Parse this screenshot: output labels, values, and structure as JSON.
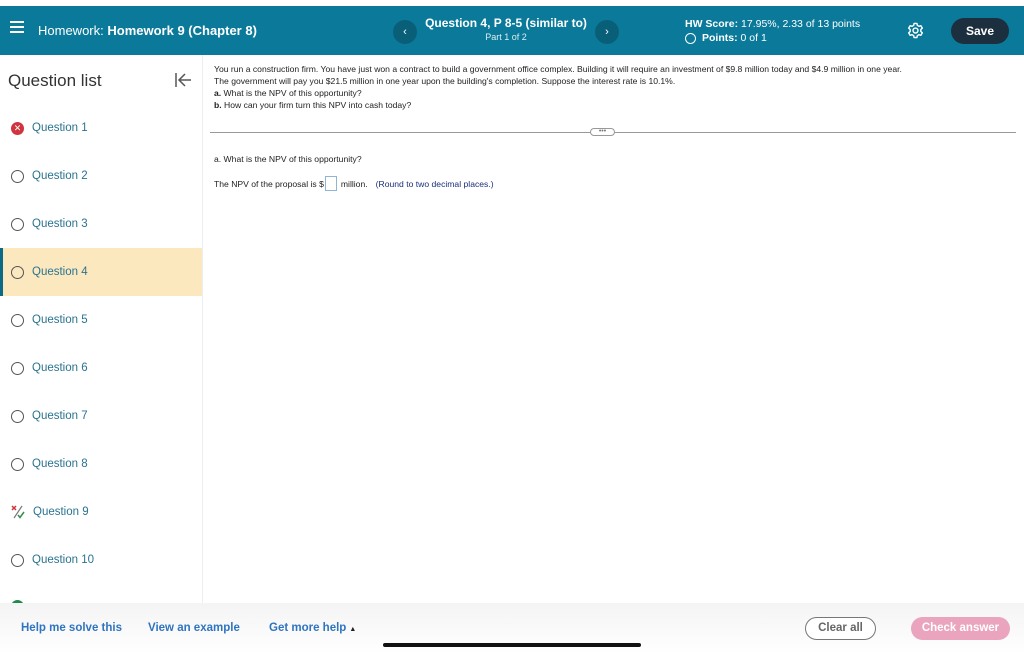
{
  "header": {
    "homework_prefix": "Homework:",
    "homework_title": "Homework 9 (Chapter 8)",
    "question_title": "Question 4, P 8-5 (similar to)",
    "question_part": "Part 1 of 2",
    "score_label": "HW Score:",
    "score_value": "17.95%, 2.33 of 13 points",
    "points_label": "Points:",
    "points_value": "0 of 1",
    "save_label": "Save",
    "prev_glyph": "‹",
    "next_glyph": "›"
  },
  "sidebar": {
    "title": "Question list",
    "items": [
      {
        "label": "Question 1",
        "status": "incorrect"
      },
      {
        "label": "Question 2",
        "status": "unanswered"
      },
      {
        "label": "Question 3",
        "status": "unanswered"
      },
      {
        "label": "Question 4",
        "status": "unanswered",
        "active": true
      },
      {
        "label": "Question 5",
        "status": "unanswered"
      },
      {
        "label": "Question 6",
        "status": "unanswered"
      },
      {
        "label": "Question 7",
        "status": "unanswered"
      },
      {
        "label": "Question 8",
        "status": "unanswered"
      },
      {
        "label": "Question 9",
        "status": "partial"
      },
      {
        "label": "Question 10",
        "status": "unanswered"
      }
    ]
  },
  "problem": {
    "line1": "You run a construction firm. You have just won a contract to build a government office complex. Building it will require an investment of $9.8 million today and $4.9 million in one year.",
    "line2": "The government will pay you $21.5 million in one year upon the building's completion. Suppose the interest rate is 10.1%.",
    "a_prefix": "a.",
    "a_text": " What is the NPV of this opportunity?",
    "b_prefix": "b.",
    "b_text": " How can your firm turn this NPV into cash today?",
    "more_glyph": "•••"
  },
  "part_a": {
    "question": "a. What is the NPV of this opportunity?",
    "answer_prefix": "The NPV of the proposal is $",
    "answer_value": "",
    "answer_suffix": "million.",
    "hint": "(Round to two decimal places.)"
  },
  "footer": {
    "help_label": "Help me solve this",
    "example_label": "View an example",
    "more_help_label": "Get more help",
    "more_help_caret": "▲",
    "clear_label": "Clear all",
    "check_label": "Check answer"
  },
  "colors": {
    "header_bg": "#0b7a9a",
    "save_bg": "#1c2f3e",
    "active_item_bg": "#fbe8bf",
    "link": "#2f74c0",
    "incorrect": "#d0353f",
    "check_disabled": "#eba4bd"
  }
}
